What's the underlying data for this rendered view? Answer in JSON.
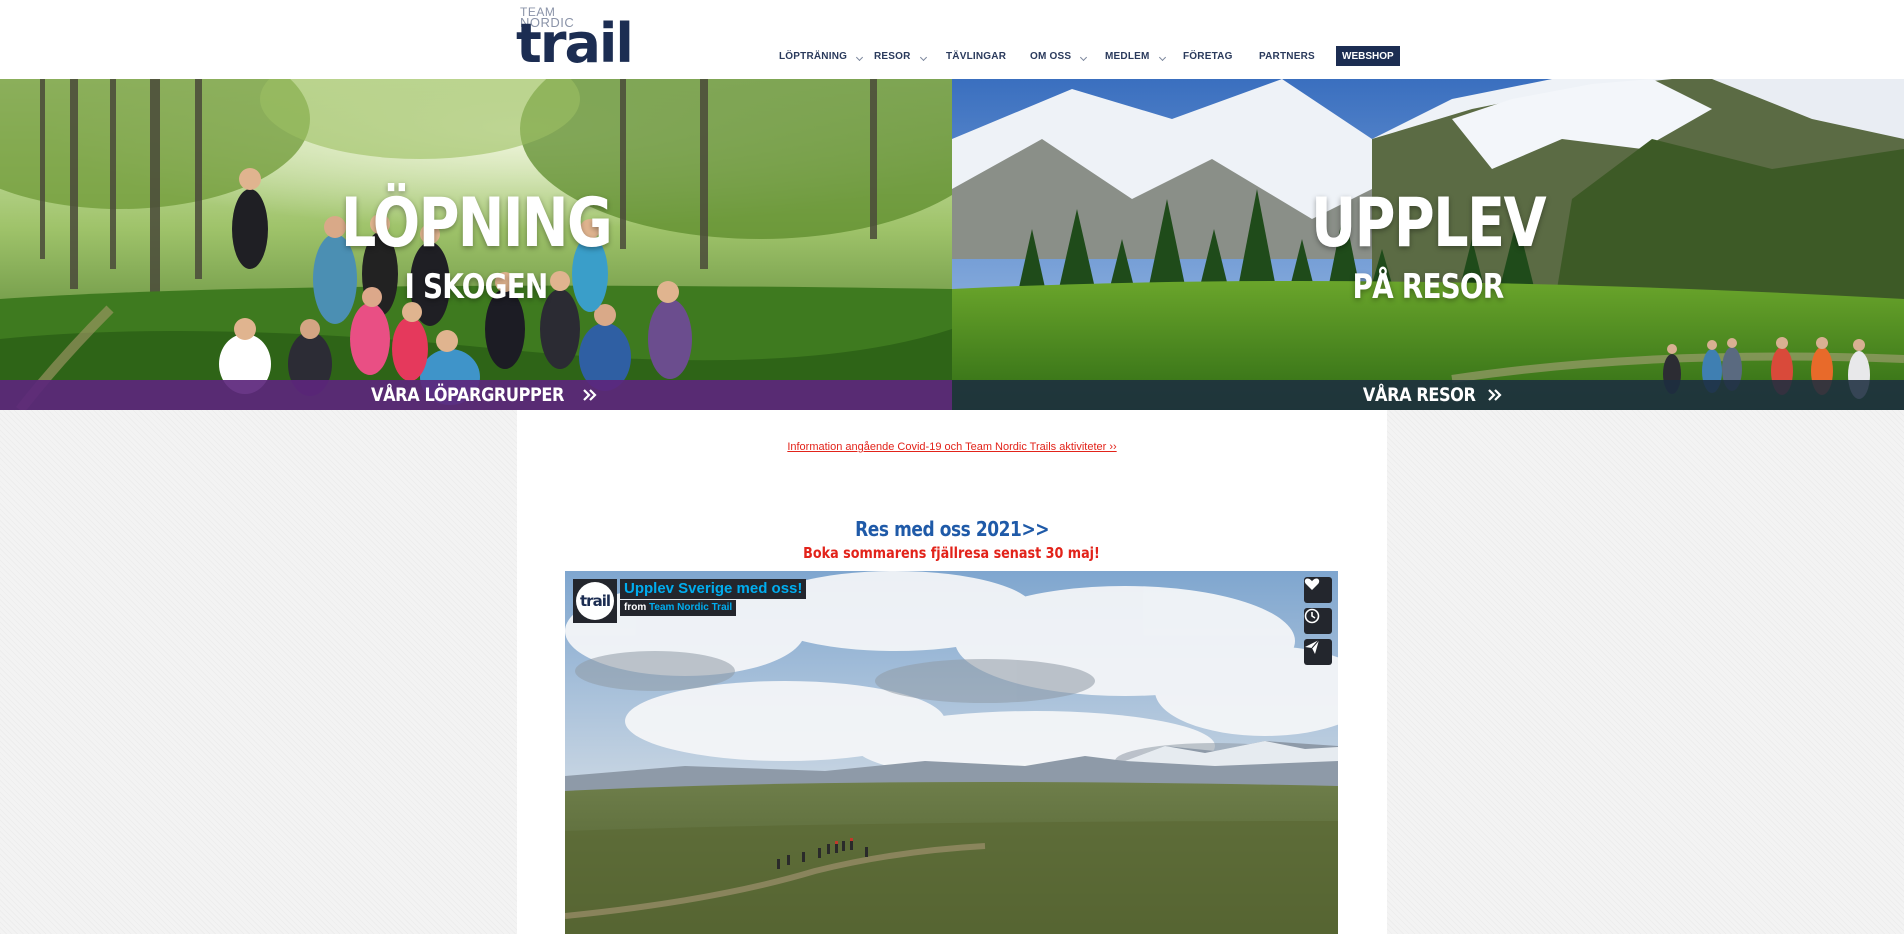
{
  "logo": {
    "team": "TEAM",
    "nordic": "NORDIC",
    "wordmark": "trail"
  },
  "nav": {
    "items": [
      {
        "label": "LÖPTRÄNING",
        "has_dropdown": true
      },
      {
        "label": "RESOR",
        "has_dropdown": true
      },
      {
        "label": "TÄVLINGAR",
        "has_dropdown": false
      },
      {
        "label": "OM OSS",
        "has_dropdown": true
      },
      {
        "label": "MEDLEM",
        "has_dropdown": true
      },
      {
        "label": "FÖRETAG",
        "has_dropdown": false
      },
      {
        "label": "PARTNERS",
        "has_dropdown": false
      }
    ],
    "webshop": "WEBSHOP",
    "chevron_icon": "chevron-down-icon"
  },
  "hero": {
    "left": {
      "title": "LÖPNING",
      "subtitle": "I SKOGEN",
      "cta": "VÅRA LÖPARGRUPPER",
      "cta_icon": "double-chevron-right-icon",
      "bar_color": "#5c267c"
    },
    "right": {
      "title": "UPPLEV",
      "subtitle": "PÅ RESOR",
      "cta": "VÅRA RESOR",
      "cta_icon": "double-chevron-right-icon",
      "bar_color": "#1c2e40"
    }
  },
  "content": {
    "covid_link": "Information angående Covid-19 och Team Nordic Trails aktiviteter ››",
    "res_link": "Res med oss 2021>>",
    "boka": "Boka sommarens fjällresa senast 30 maj!"
  },
  "video": {
    "avatar_text": "trail",
    "title": "Upplev Sverige med oss!",
    "from_label": "from",
    "from_channel": "Team Nordic Trail",
    "buttons": [
      "heart-icon",
      "clock-icon",
      "send-icon"
    ]
  },
  "colors": {
    "navy": "#1c2d52",
    "link_red": "#e2231a",
    "link_blue": "#1f5aa8",
    "video_accent": "#00adef"
  }
}
